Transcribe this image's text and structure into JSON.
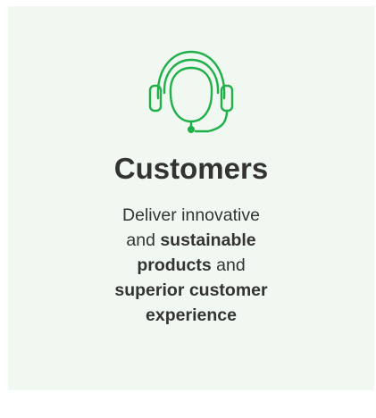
{
  "card": {
    "title": "Customers",
    "icon": "headset-icon",
    "accent_color": "#1fb04a",
    "background_color": "#f0f8f1",
    "description": {
      "line1": {
        "text_a": "Deliver innovative"
      },
      "line2": {
        "text_a": "and ",
        "bold_a": "sustainable"
      },
      "line3": {
        "bold_a": "products",
        "text_a": " and"
      },
      "line4": {
        "bold_a": "superior customer"
      },
      "line5": {
        "bold_a": "experience"
      }
    }
  }
}
